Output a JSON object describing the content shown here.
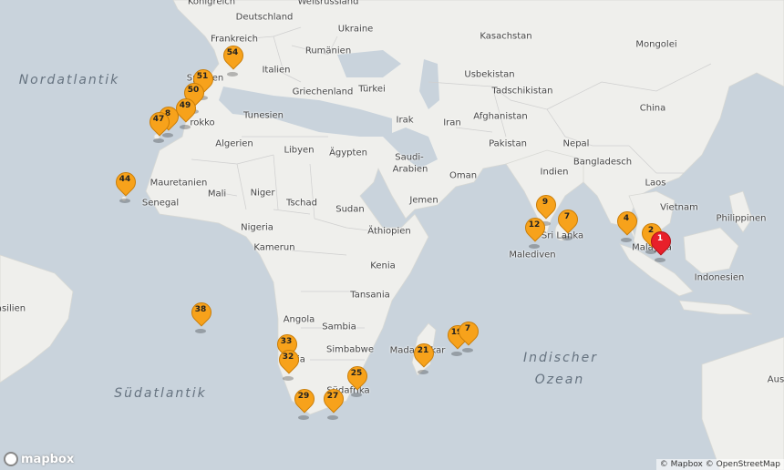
{
  "map": {
    "place_labels": [
      {
        "id": "koenigreich",
        "text": "Königreich"
      },
      {
        "id": "weissrussland",
        "text": "Weißrussland"
      },
      {
        "id": "deutschland",
        "text": "Deutschland"
      },
      {
        "id": "ukraine",
        "text": "Ukraine"
      },
      {
        "id": "frankreich",
        "text": "Frankreich"
      },
      {
        "id": "rumaenien",
        "text": "Rumänien"
      },
      {
        "id": "kasachstan",
        "text": "Kasachstan"
      },
      {
        "id": "mongolei",
        "text": "Mongolei"
      },
      {
        "id": "italien",
        "text": "Italien"
      },
      {
        "id": "spanien",
        "text": "Spanien"
      },
      {
        "id": "usbekistan",
        "text": "Usbekistan"
      },
      {
        "id": "griechenland",
        "text": "Griechenland"
      },
      {
        "id": "tuerkei",
        "text": "Türkei"
      },
      {
        "id": "tadschikistan",
        "text": "Tadschikistan"
      },
      {
        "id": "tunesien",
        "text": "Tunesien"
      },
      {
        "id": "irak",
        "text": "Irak"
      },
      {
        "id": "iran",
        "text": "Iran"
      },
      {
        "id": "afghanistan",
        "text": "Afghanistan"
      },
      {
        "id": "china",
        "text": "China"
      },
      {
        "id": "marokko",
        "text": "rokko"
      },
      {
        "id": "algerien",
        "text": "Algerien"
      },
      {
        "id": "libyen",
        "text": "Libyen"
      },
      {
        "id": "aegypten",
        "text": "Ägypten"
      },
      {
        "id": "pakistan",
        "text": "Pakistan"
      },
      {
        "id": "nepal",
        "text": "Nepal"
      },
      {
        "id": "saudi",
        "text": "Saudi-"
      },
      {
        "id": "arabien",
        "text": "Arabien"
      },
      {
        "id": "bangladesch",
        "text": "Bangladesch"
      },
      {
        "id": "oman",
        "text": "Oman"
      },
      {
        "id": "indien",
        "text": "Indien"
      },
      {
        "id": "mauretanien",
        "text": "Mauretanien"
      },
      {
        "id": "mali",
        "text": "Mali"
      },
      {
        "id": "niger",
        "text": "Niger"
      },
      {
        "id": "laos",
        "text": "Laos"
      },
      {
        "id": "jemen",
        "text": "Jemen"
      },
      {
        "id": "tschad",
        "text": "Tschad"
      },
      {
        "id": "senegal",
        "text": "Senegal"
      },
      {
        "id": "sudan",
        "text": "Sudan"
      },
      {
        "id": "vietnam",
        "text": "Vietnam"
      },
      {
        "id": "philippinen",
        "text": "Philippinen"
      },
      {
        "id": "nigeria",
        "text": "Nigeria"
      },
      {
        "id": "aethiopien",
        "text": "Äthiopien"
      },
      {
        "id": "srilanka",
        "text": "Sri Lanka"
      },
      {
        "id": "malediven",
        "text": "Malediven"
      },
      {
        "id": "kamerun",
        "text": "Kamerun"
      },
      {
        "id": "malaysia",
        "text": "Malaysia"
      },
      {
        "id": "kenia",
        "text": "Kenia"
      },
      {
        "id": "indonesien",
        "text": "Indonesien"
      },
      {
        "id": "tansania",
        "text": "Tansania"
      },
      {
        "id": "brasilien",
        "text": "asilien"
      },
      {
        "id": "angola",
        "text": "Angola"
      },
      {
        "id": "sambia",
        "text": "Sambia"
      },
      {
        "id": "madagaskar",
        "text": "Madagaskar"
      },
      {
        "id": "simbabwe",
        "text": "Simbabwe"
      },
      {
        "id": "namibia",
        "text": "mibia"
      },
      {
        "id": "suedafrika",
        "text": "Südafrika"
      },
      {
        "id": "australien",
        "text": "Aus"
      }
    ],
    "sea_labels": [
      {
        "id": "nordatlantik",
        "text": "Nordatlantik"
      },
      {
        "id": "suedatlantik",
        "text": "Südatlantik"
      },
      {
        "id": "indischer",
        "text": "Indischer"
      },
      {
        "id": "ozean",
        "text": "Ozean"
      }
    ],
    "markers": [
      {
        "label": "54",
        "active": false
      },
      {
        "label": "51",
        "active": false
      },
      {
        "label": "50",
        "active": false
      },
      {
        "label": "49",
        "active": false
      },
      {
        "label": "8",
        "active": false
      },
      {
        "label": "47",
        "active": false
      },
      {
        "label": "44",
        "active": false
      },
      {
        "label": "9",
        "active": false
      },
      {
        "label": "12",
        "active": false
      },
      {
        "label": "7",
        "active": false
      },
      {
        "label": "4",
        "active": false
      },
      {
        "label": "2",
        "active": false
      },
      {
        "label": "1",
        "active": true
      },
      {
        "label": "38",
        "active": false
      },
      {
        "label": "33",
        "active": false
      },
      {
        "label": "32",
        "active": false
      },
      {
        "label": "19",
        "active": false
      },
      {
        "label": "7",
        "active": false
      },
      {
        "label": "21",
        "active": false
      },
      {
        "label": "25",
        "active": false
      },
      {
        "label": "29",
        "active": false
      },
      {
        "label": "27",
        "active": false
      }
    ],
    "marker_color": "#f7a21b",
    "active_marker_color": "#e8202a",
    "logo_text": "mapbox",
    "attribution": "© Mapbox © OpenStreetMap"
  }
}
